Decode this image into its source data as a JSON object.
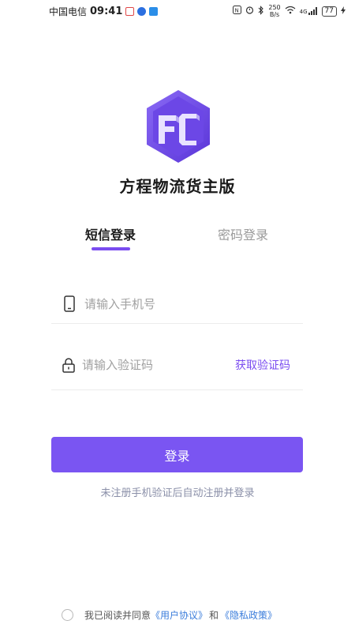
{
  "status_bar": {
    "carrier": "中国电信",
    "time": "09:41",
    "network_speed_value": "250",
    "network_speed_unit": "B/s",
    "signal_label": "4G",
    "battery": "77"
  },
  "app": {
    "title": "方程物流货主版"
  },
  "tabs": [
    {
      "label": "短信登录",
      "active": true
    },
    {
      "label": "密码登录",
      "active": false
    }
  ],
  "form": {
    "phone_placeholder": "请输入手机号",
    "code_placeholder": "请输入验证码",
    "get_code_label": "获取验证码"
  },
  "login_button_label": "登录",
  "hint_text": "未注册手机验证后自动注册并登录",
  "agreement": {
    "prefix": "我已阅读并同意",
    "user_agreement": "《用户协议》",
    "and": "和",
    "privacy_policy": "《隐私政策》",
    "checked": false
  },
  "colors": {
    "accent": "#7a55f2",
    "link": "#3b7ddb",
    "hint": "#8a8fa8"
  }
}
